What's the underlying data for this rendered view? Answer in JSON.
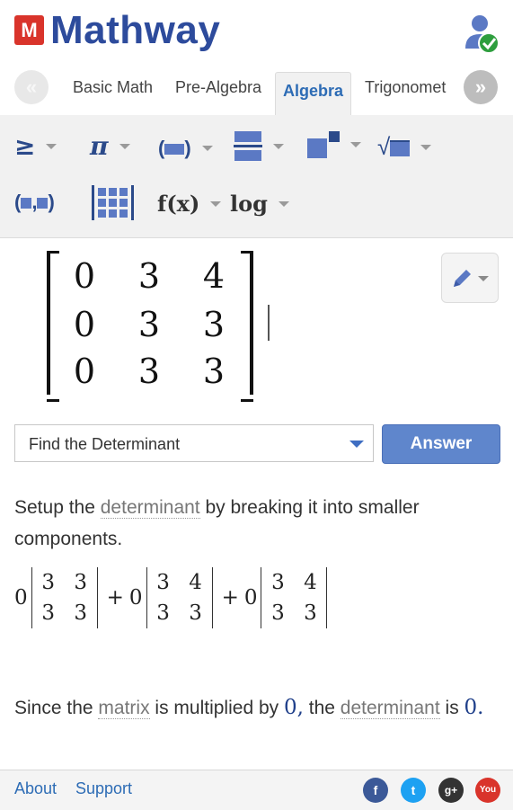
{
  "header": {
    "logo_mark": "M",
    "logo_text": "Mathway"
  },
  "tabs": [
    {
      "label": "Basic Math",
      "active": false
    },
    {
      "label": "Pre-Algebra",
      "active": false
    },
    {
      "label": "Algebra",
      "active": true
    },
    {
      "label": "Trigonomet",
      "active": false
    }
  ],
  "palette": {
    "row1": [
      "inequality",
      "pi",
      "parentheses",
      "fraction",
      "exponent",
      "radical"
    ],
    "row2": [
      "ordered-pair",
      "matrix",
      "f(x)",
      "log"
    ],
    "symbols": {
      "inequality": "≥",
      "pi": "π",
      "function": "f(x)",
      "log": "log"
    }
  },
  "matrix": {
    "rows": [
      [
        "0",
        "3",
        "4"
      ],
      [
        "0",
        "3",
        "3"
      ],
      [
        "0",
        "3",
        "3"
      ]
    ]
  },
  "action": {
    "selected": "Find the Determinant",
    "answer_label": "Answer"
  },
  "solution": {
    "step1_a": "Setup the ",
    "step1_term": "determinant",
    "step1_b": " by breaking it into smaller components.",
    "dets": [
      {
        "coef": "0",
        "cells": [
          "3",
          "3",
          "3",
          "3"
        ]
      },
      {
        "op": "+",
        "coef": "0",
        "cells": [
          "3",
          "4",
          "3",
          "3"
        ]
      },
      {
        "op": "+",
        "coef": "0",
        "cells": [
          "3",
          "4",
          "3",
          "3"
        ]
      }
    ],
    "step2_a": "Since the ",
    "step2_term1": "matrix",
    "step2_b": " is multiplied by ",
    "step2_val": "0,",
    "step2_c": " the ",
    "step2_term2": "determinant",
    "step2_d": " is ",
    "step2_val2": "0."
  },
  "footer": {
    "about": "About",
    "support": "Support",
    "social": [
      {
        "name": "facebook",
        "glyph": "f",
        "color": "#3b5998"
      },
      {
        "name": "twitter",
        "glyph": "t",
        "color": "#1da1f2"
      },
      {
        "name": "google-plus",
        "glyph": "g+",
        "color": "#333333"
      },
      {
        "name": "youtube",
        "glyph": "You",
        "color": "#d9342b"
      }
    ]
  },
  "colors": {
    "brand_blue": "#2d4b9c",
    "brand_red": "#d9342b",
    "accent": "#5f86cc"
  }
}
